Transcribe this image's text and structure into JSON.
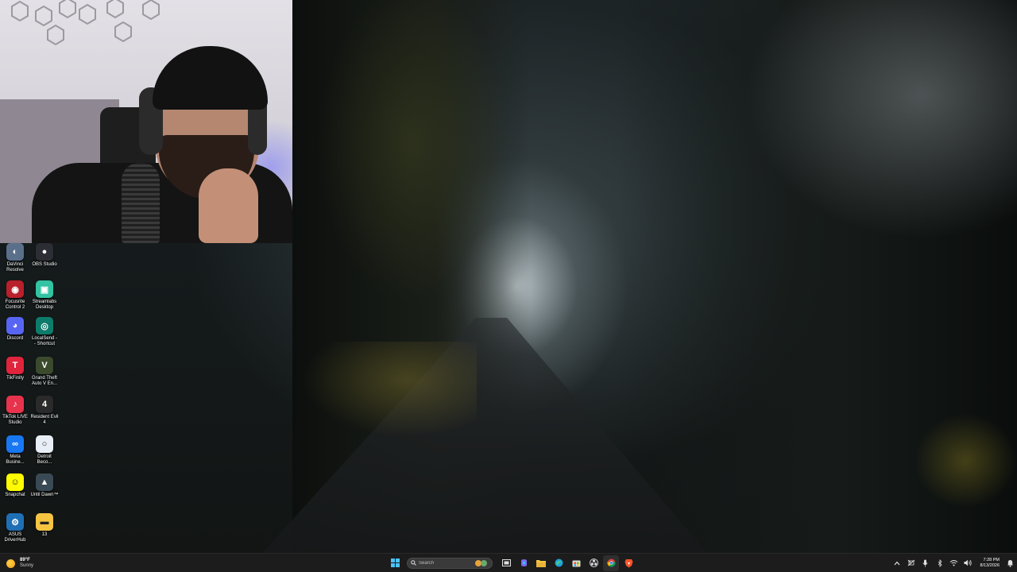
{
  "desktop": {
    "icons": [
      {
        "name": "DaVinci Resolve",
        "label": "DaVinci\nResolve",
        "icon": "davinci-resolve-icon",
        "color": "#5a6f8a"
      },
      {
        "name": "OBS Studio",
        "label": "OBS Studio",
        "icon": "obs-studio-icon",
        "color": "#2d2d35"
      },
      {
        "name": "Focusrite Control 2",
        "label": "Focusrite\nControl 2",
        "icon": "focusrite-icon",
        "color": "#b8202c"
      },
      {
        "name": "Streamlabs Desktop",
        "label": "Streamlabs\nDesktop",
        "icon": "streamlabs-icon",
        "color": "#31c3a2"
      },
      {
        "name": "Discord",
        "label": "Discord",
        "icon": "discord-icon",
        "color": "#5865f2"
      },
      {
        "name": "LocalSend - Shortcut",
        "label": "LocalSend -\n- Shortcut",
        "icon": "localsend-icon",
        "color": "#0e7c6a"
      },
      {
        "name": "TikFinity",
        "label": "TikFinity",
        "icon": "tikfinity-icon",
        "color": "#e0243c"
      },
      {
        "name": "Grand Theft Auto V Enhanced",
        "label": "Grand Theft\nAuto V En...",
        "icon": "gta-v-icon",
        "color": "#3b4a2c"
      },
      {
        "name": "TikTok LIVE Studio",
        "label": "TikTok LIVE\nStudio",
        "icon": "tiktok-live-studio-icon",
        "color": "#e8334d"
      },
      {
        "name": "Resident Evil 4",
        "label": "Resident Evil\n4",
        "icon": "resident-evil-4-icon",
        "color": "#2a2a2a"
      },
      {
        "name": "Meta Business Suite",
        "label": "Meta\nBusine...",
        "icon": "meta-icon",
        "color": "#1877f2"
      },
      {
        "name": "Detroit Become Human",
        "label": "Detroit\nBeco...",
        "icon": "detroit-icon",
        "color": "#e8eef5"
      },
      {
        "name": "Snapchat",
        "label": "Snapchat",
        "icon": "snapchat-icon",
        "color": "#fffc00"
      },
      {
        "name": "Until Dawn",
        "label": "Until Dawn™",
        "icon": "until-dawn-icon",
        "color": "#3a4a55"
      },
      {
        "name": "ASUS DriverHub",
        "label": "ASUS\nDriverHub",
        "icon": "asus-driverhub-icon",
        "color": "#1f6fb5"
      },
      {
        "name": "13",
        "label": "13",
        "icon": "folder-icon",
        "color": "#f5c542"
      }
    ]
  },
  "taskbar": {
    "weather": {
      "temp": "89°F",
      "condition": "Sunny"
    },
    "search_placeholder": "Search",
    "pinned": [
      {
        "name": "task-view",
        "icon": "task-view-icon"
      },
      {
        "name": "copilot",
        "icon": "copilot-icon"
      },
      {
        "name": "file-explorer",
        "icon": "file-explorer-icon"
      },
      {
        "name": "edge",
        "icon": "edge-icon"
      },
      {
        "name": "store",
        "icon": "microsoft-store-icon"
      },
      {
        "name": "obs",
        "icon": "obs-studio-icon"
      },
      {
        "name": "chrome",
        "icon": "chrome-icon"
      },
      {
        "name": "brave",
        "icon": "brave-icon"
      }
    ],
    "clock": {
      "time": "7:28 PM",
      "date": "8/13/2026"
    }
  }
}
